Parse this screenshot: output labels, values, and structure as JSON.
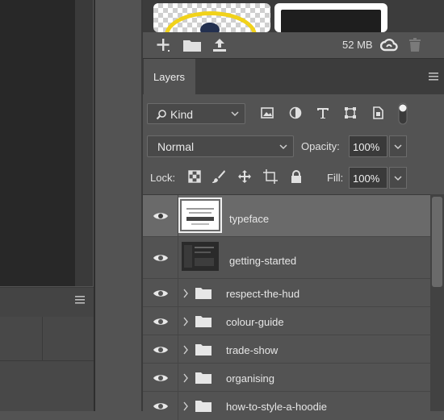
{
  "library": {
    "memory": "52 MB",
    "icons": [
      "add-icon",
      "folder-icon",
      "upload-icon",
      "creative-cloud-icon",
      "trash-icon"
    ]
  },
  "tabs": {
    "layers": "Layers"
  },
  "filter": {
    "kind_label": "Kind",
    "icons": [
      "search-icon",
      "image-filter-icon",
      "adjustment-filter-icon",
      "type-filter-icon",
      "shape-filter-icon",
      "smart-object-filter-icon",
      "filter-toggle-icon"
    ]
  },
  "blend": {
    "mode": "Normal",
    "opacity_label": "Opacity:",
    "opacity_value": "100%"
  },
  "lock": {
    "label": "Lock:",
    "icons": [
      "lock-transparency-icon",
      "lock-paint-icon",
      "lock-position-icon",
      "lock-artboard-icon",
      "lock-all-icon"
    ],
    "fill_label": "Fill:",
    "fill_value": "100%"
  },
  "layers": [
    {
      "name": "typeface",
      "type": "smart",
      "selected": true
    },
    {
      "name": "getting-started",
      "type": "smart",
      "selected": false
    },
    {
      "name": "respect-the-hud",
      "type": "group"
    },
    {
      "name": "colour-guide",
      "type": "group"
    },
    {
      "name": "trade-show",
      "type": "group"
    },
    {
      "name": "organising",
      "type": "group"
    },
    {
      "name": "how-to-style-a-hoodie",
      "type": "group"
    }
  ],
  "colors": {
    "panel": "#535353",
    "dark": "#3c3c3c",
    "canvas": "#282828",
    "swatch_yellow": "#f1d21a"
  }
}
